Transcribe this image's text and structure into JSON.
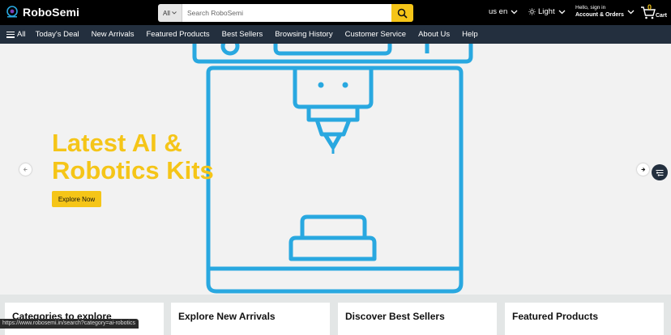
{
  "header": {
    "brand": "RoboSemi",
    "search": {
      "category": "All",
      "placeholder": "Search RoboSemi",
      "value": ""
    },
    "locale": "us en",
    "theme": "Light",
    "account": {
      "greeting": "Hello, sign in",
      "label": "Account & Orders"
    },
    "cart": {
      "count": "0",
      "label": "Cart"
    }
  },
  "nav": {
    "all_label": "All",
    "items": [
      "Today's Deal",
      "New Arrivals",
      "Featured Products",
      "Best Sellers",
      "Browsing History",
      "Customer Service",
      "About Us",
      "Help"
    ]
  },
  "hero": {
    "title_line1": "Latest AI &",
    "title_line2": "Robotics Kits",
    "cta": "Explore Now"
  },
  "cards": [
    "Categories to explore",
    "Explore New Arrivals",
    "Discover Best Sellers",
    "Featured Products"
  ],
  "status_url": "https://www.robosemi.in/search?category=ai-robotics",
  "colors": {
    "accent": "#f5c518",
    "topbar": "#000000",
    "navbar": "#232f3e",
    "illustration": "#29a8e0"
  },
  "icons": {
    "search": "search-icon",
    "theme": "sun-icon",
    "cart": "cart-icon",
    "menu": "hamburger-icon",
    "prev": "chevron-left-icon",
    "next": "chevron-right-icon",
    "filter": "filter-icon"
  }
}
